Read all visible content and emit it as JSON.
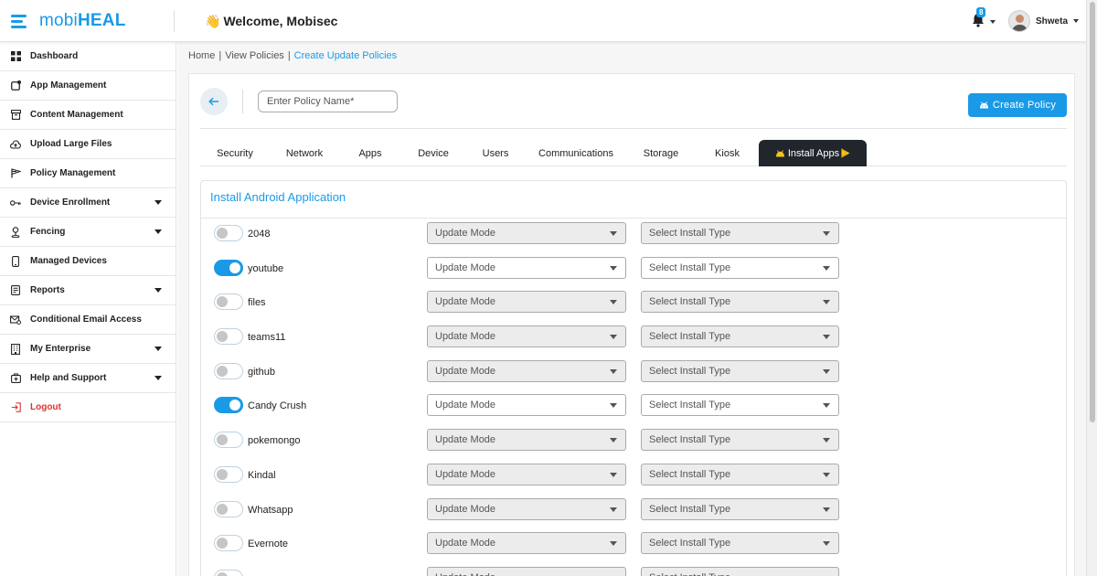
{
  "app": {
    "brand_prefix": "mobi",
    "brand_bold": "HEAL",
    "welcome_wave": "👋",
    "welcome": "Welcome, Mobisec"
  },
  "header": {
    "notification_count": "8",
    "user_name": "Shweta"
  },
  "sidebar": {
    "items": [
      {
        "label": "Dashboard",
        "icon": "dashboard-icon",
        "dropdown": false
      },
      {
        "label": "App Management",
        "icon": "app-management-icon",
        "dropdown": false
      },
      {
        "label": "Content Management",
        "icon": "archive-icon",
        "dropdown": false
      },
      {
        "label": "Upload Large Files",
        "icon": "cloud-upload-icon",
        "dropdown": false
      },
      {
        "label": "Policy Management",
        "icon": "flag-icon",
        "dropdown": false
      },
      {
        "label": "Device Enrollment",
        "icon": "key-icon",
        "dropdown": true
      },
      {
        "label": "Fencing",
        "icon": "map-pin-icon",
        "dropdown": true
      },
      {
        "label": "Managed Devices",
        "icon": "mobile-icon",
        "dropdown": false
      },
      {
        "label": "Reports",
        "icon": "report-icon",
        "dropdown": true
      },
      {
        "label": "Conditional Email Access",
        "icon": "mail-icon",
        "dropdown": false
      },
      {
        "label": "My Enterprise",
        "icon": "building-icon",
        "dropdown": true
      },
      {
        "label": "Help and Support",
        "icon": "help-icon",
        "dropdown": true
      },
      {
        "label": "Logout",
        "icon": "logout-icon",
        "dropdown": false
      }
    ]
  },
  "breadcrumb": {
    "home": "Home",
    "sep1": "|",
    "view": "View Policies",
    "sep2": "|",
    "current": "Create Update Policies"
  },
  "policy": {
    "name_placeholder": "Enter Policy Name*",
    "create_label": "Create Policy"
  },
  "tabs": [
    "Security",
    "Network",
    "Apps",
    "Device",
    "Users",
    "Communications",
    "Storage",
    "Kiosk",
    "Install Apps"
  ],
  "active_tab": "Install Apps",
  "panel": {
    "title": "Install Android Application"
  },
  "apps": [
    {
      "name": "2048",
      "enabled": false,
      "update_mode": "Update Mode",
      "install_type": "Select Install Type"
    },
    {
      "name": "youtube",
      "enabled": true,
      "update_mode": "Update Mode",
      "install_type": "Select Install Type"
    },
    {
      "name": "files",
      "enabled": false,
      "update_mode": "Update Mode",
      "install_type": "Select Install Type"
    },
    {
      "name": "teams11",
      "enabled": false,
      "update_mode": "Update Mode",
      "install_type": "Select Install Type"
    },
    {
      "name": "github",
      "enabled": false,
      "update_mode": "Update Mode",
      "install_type": "Select Install Type"
    },
    {
      "name": "Candy Crush",
      "enabled": true,
      "update_mode": "Update Mode",
      "install_type": "Select Install Type"
    },
    {
      "name": "pokemongo",
      "enabled": false,
      "update_mode": "Update Mode",
      "install_type": "Select Install Type"
    },
    {
      "name": "Kindal",
      "enabled": false,
      "update_mode": "Update Mode",
      "install_type": "Select Install Type"
    },
    {
      "name": "Whatsapp",
      "enabled": false,
      "update_mode": "Update Mode",
      "install_type": "Select Install Type"
    },
    {
      "name": "Evernote",
      "enabled": false,
      "update_mode": "Update Mode",
      "install_type": "Select Install Type"
    },
    {
      "name": "",
      "enabled": false,
      "update_mode": "Update Mode",
      "install_type": "Select Install Type"
    }
  ],
  "colors": {
    "accent": "#1a9ae6",
    "active_tab_bg": "#21262c",
    "logout": "#e03131"
  }
}
